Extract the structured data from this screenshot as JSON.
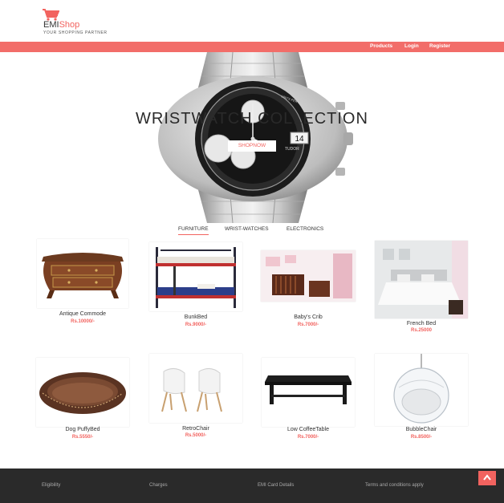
{
  "header": {
    "brand_emi": "EMI",
    "brand_shop": "Shop",
    "tagline": "YOUR SHOPPING PARTNER"
  },
  "nav": {
    "products": "Products",
    "login": "Login",
    "register": "Register"
  },
  "hero": {
    "title": "WRISTWATCH COLLECTION",
    "button": "SHOPNOW",
    "dial_brand": "TUDOR",
    "dial_rolex": "UNITS PER HOUR",
    "dial_date": "14"
  },
  "tabs": {
    "furniture": "FURNITURE",
    "wristwatches": "WRIST-WATCHES",
    "electronics": "ELECTRONICS"
  },
  "products": [
    {
      "name": "Antique Commode",
      "price": "Rs.10000/-"
    },
    {
      "name": "BunkBed",
      "price": "Rs.9000/-"
    },
    {
      "name": "Baby's Crib",
      "price": "Rs.7000/-"
    },
    {
      "name": "French Bed",
      "price": "Rs.25000"
    },
    {
      "name": "Dog PuffyBed",
      "price": "Rs.5550/-"
    },
    {
      "name": "RetroChair",
      "price": "Rs.5000/-"
    },
    {
      "name": "Low CoffeeTable",
      "price": "Rs.7000/-"
    },
    {
      "name": "BubbleChair",
      "price": "Rs.8500/-"
    }
  ],
  "footer": {
    "eligibility": "Eligibility",
    "charges": "Charges",
    "emi_card": "EMI Card Details",
    "terms": "Terms and conditions apply"
  },
  "colors": {
    "accent": "#f2635f",
    "navbar": "#f26d69",
    "footer": "#2a2a2a"
  }
}
